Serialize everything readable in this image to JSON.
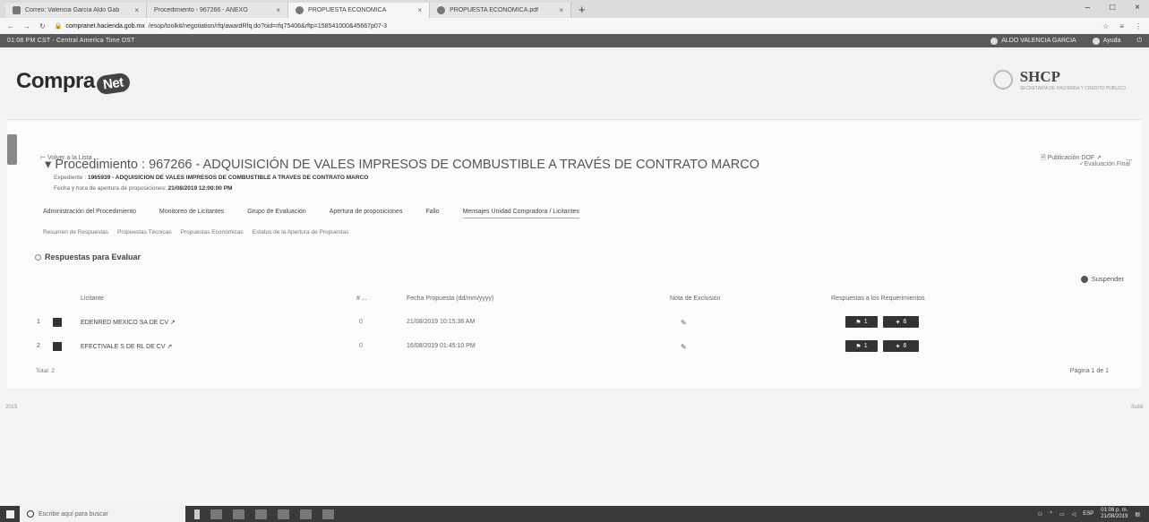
{
  "browser": {
    "tabs": [
      {
        "title": "Correo: Valencia García Aldo Gab",
        "active": false
      },
      {
        "title": "Procedimiento - 967266 - ANEXO",
        "active": false
      },
      {
        "title": "PROPUESTA ECONOMICA",
        "active": true
      },
      {
        "title": "PROPUESTA ECONOMICA.pdf",
        "active": false
      }
    ],
    "new_tab": "+",
    "window_controls": [
      "–",
      "□",
      "×"
    ],
    "address": {
      "domain": "compranet.hacienda.gob.mx",
      "path": "/esop/toolkit/negotiation/rfq/awardRfq.do?oid=rfq75406&rftp=158541000&45667p07-3",
      "star": "☆"
    }
  },
  "system_bar": {
    "time": "01:08 PM CST - Central America Time DST",
    "user": "ALDO VALENCIA GARCIA",
    "help": "Ayuda"
  },
  "header": {
    "logo_text": "Compra",
    "logo_net": "Net",
    "shcp": "SHCP",
    "shcp_sub": "SECRETARÍA DE HACIENDA Y CRÉDITO PÚBLICO"
  },
  "procedure": {
    "back_link": "Volver a la Lista",
    "publish_doc": "Publicación DOF",
    "more": "...",
    "title": "Procedimiento : 967266 - ADQUISICIÓN DE VALES IMPRESOS DE COMBUSTIBLE A TRAVÉS DE CONTRATO MARCO",
    "evaluation_status": "Evaluación Final",
    "expediente_label": "Expediente :",
    "expediente_value": "1965939 - ADQUISICION DE VALES IMPRESOS DE COMBUSTIBLE A TRAVES DE CONTRATO MARCO",
    "fecha_label": "Fecha y hora de apertura de proposiciones:",
    "fecha_value": "21/08/2019 12:00:00 PM"
  },
  "tabs_main": [
    "Administración del Procedimiento",
    "Monitoreo de Licitantes",
    "Grupo de Evaluación",
    "Apertura de proposiciones",
    "Fallo",
    "Mensajes Unidad Compradora / Licitantes"
  ],
  "tabs_sub": [
    "Resumen de Respuestas",
    "Propuestas Técnicas",
    "Propuestas Económicas",
    "Estatus de la Apertura de Propuestas"
  ],
  "section": {
    "title": "Respuestas para Evaluar",
    "suspend": "Suspender"
  },
  "table": {
    "headers": {
      "licitante": "Licitante",
      "count": "# ...",
      "fecha": "Fecha Propuesta (dd/mm/yyyy)",
      "nota": "Nota de Exclusión",
      "respuestas": "Respuestas a los Requerimientos"
    },
    "rows": [
      {
        "num": "1",
        "name": "EDENRED MEXICO SA DE CV",
        "count": "0",
        "date": "21/08/2019 10:15:36 AM",
        "note": "✎",
        "btn1": "1",
        "btn2": "6"
      },
      {
        "num": "2",
        "name": "EFECTIVALE S DE RL DE CV",
        "count": "0",
        "date": "16/08/2019 01:45:10 PM",
        "note": "✎",
        "btn1": "1",
        "btn2": "6"
      }
    ],
    "total": "Total: 2",
    "pages": "Página 1 de 1"
  },
  "footer": {
    "left": "2015",
    "right": "Subir"
  },
  "taskbar": {
    "search_placeholder": "Escribe aquí para buscar",
    "lang": "ESP",
    "time": "01:08 p. m.",
    "date": "21/08/2019"
  }
}
